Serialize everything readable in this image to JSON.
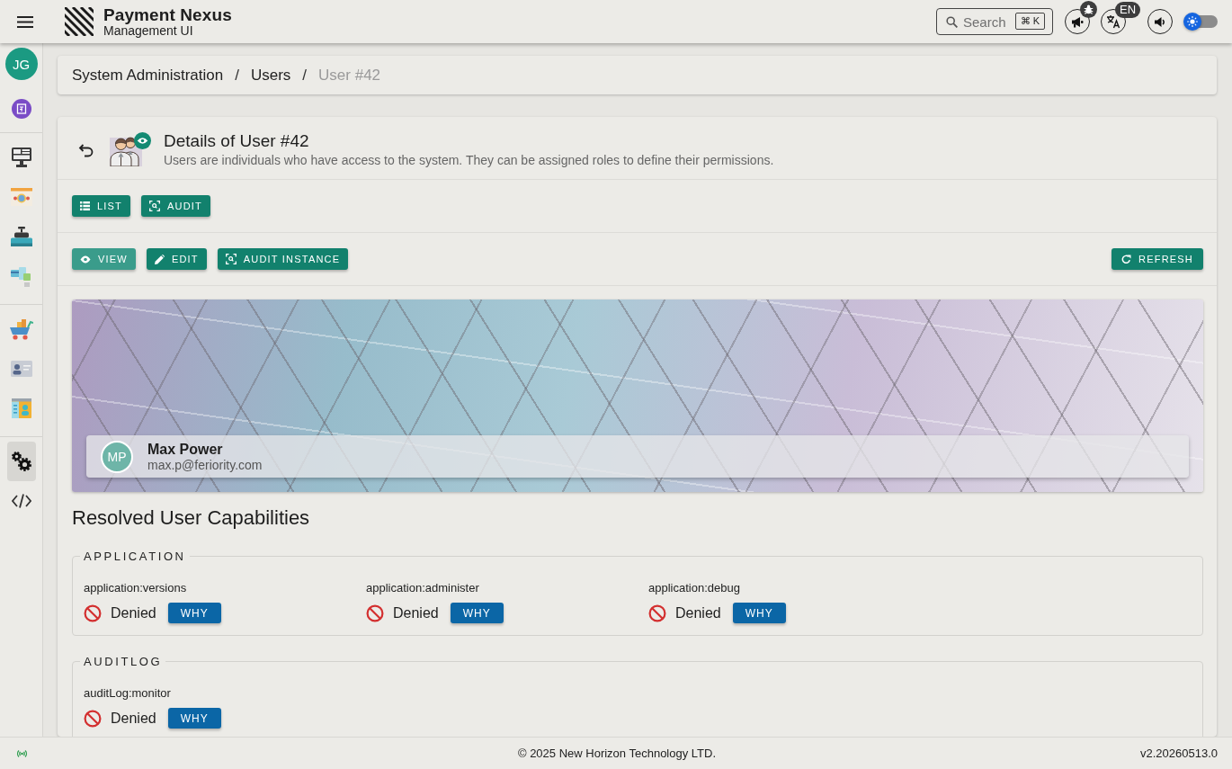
{
  "top_bar": {
    "brand": {
      "title": "Payment Nexus",
      "subtitle": "Management UI"
    },
    "search": {
      "placeholder": "Search",
      "shortcut": "⌘ K"
    },
    "language_badge": "EN",
    "theme_switch": {
      "on": false
    }
  },
  "sidebar": {
    "user_avatar": {
      "initials": "JG"
    },
    "groups": [
      {
        "items": [
          {
            "selected": false
          },
          {
            "selected": false
          },
          {
            "selected": false
          },
          {
            "selected": false
          }
        ]
      },
      {
        "items": [
          {
            "selected": false
          },
          {
            "selected": false
          },
          {
            "selected": false
          }
        ]
      },
      {
        "items": [
          {
            "selected": true
          },
          {
            "selected": false
          }
        ]
      }
    ]
  },
  "breadcrumb": {
    "items": [
      {
        "label": "System Administration",
        "disabled": false
      },
      {
        "label": "Users",
        "disabled": false
      },
      {
        "label": "User #42",
        "disabled": true
      }
    ],
    "separators": [
      "/",
      "/"
    ]
  },
  "page_header": {
    "title": "Details of User #42",
    "description": "Users are individuals who have access to the system. They can be assigned roles to define their permissions."
  },
  "resource_actions": [
    {
      "label": "LIST"
    },
    {
      "label": "AUDIT"
    }
  ],
  "instance_actions": [
    {
      "label": "VIEW",
      "selected": true
    },
    {
      "label": "EDIT",
      "selected": false
    },
    {
      "label": "AUDIT INSTANCE",
      "selected": false
    }
  ],
  "refresh_button": {
    "label": "REFRESH"
  },
  "profile": {
    "initials": "MP",
    "name": "Max Power",
    "email": "max.p@feriority.com"
  },
  "capabilities": {
    "title": "Resolved User Capabilities",
    "groups": [
      {
        "name": "APPLICATION",
        "items": [
          {
            "name": "application:versions",
            "granted": false,
            "status": "Denied",
            "action": "WHY"
          },
          {
            "name": "application:administer",
            "granted": false,
            "status": "Denied",
            "action": "WHY"
          },
          {
            "name": "application:debug",
            "granted": false,
            "status": "Denied",
            "action": "WHY"
          }
        ]
      },
      {
        "name": "AUDITLOG",
        "items": [
          {
            "name": "auditLog:monitor",
            "granted": false,
            "status": "Denied",
            "action": "WHY"
          }
        ]
      }
    ]
  },
  "footer": {
    "connected": true,
    "copyright": "© 2025 New Horizon Technology LTD.",
    "version": "v2.20260513.0"
  }
}
